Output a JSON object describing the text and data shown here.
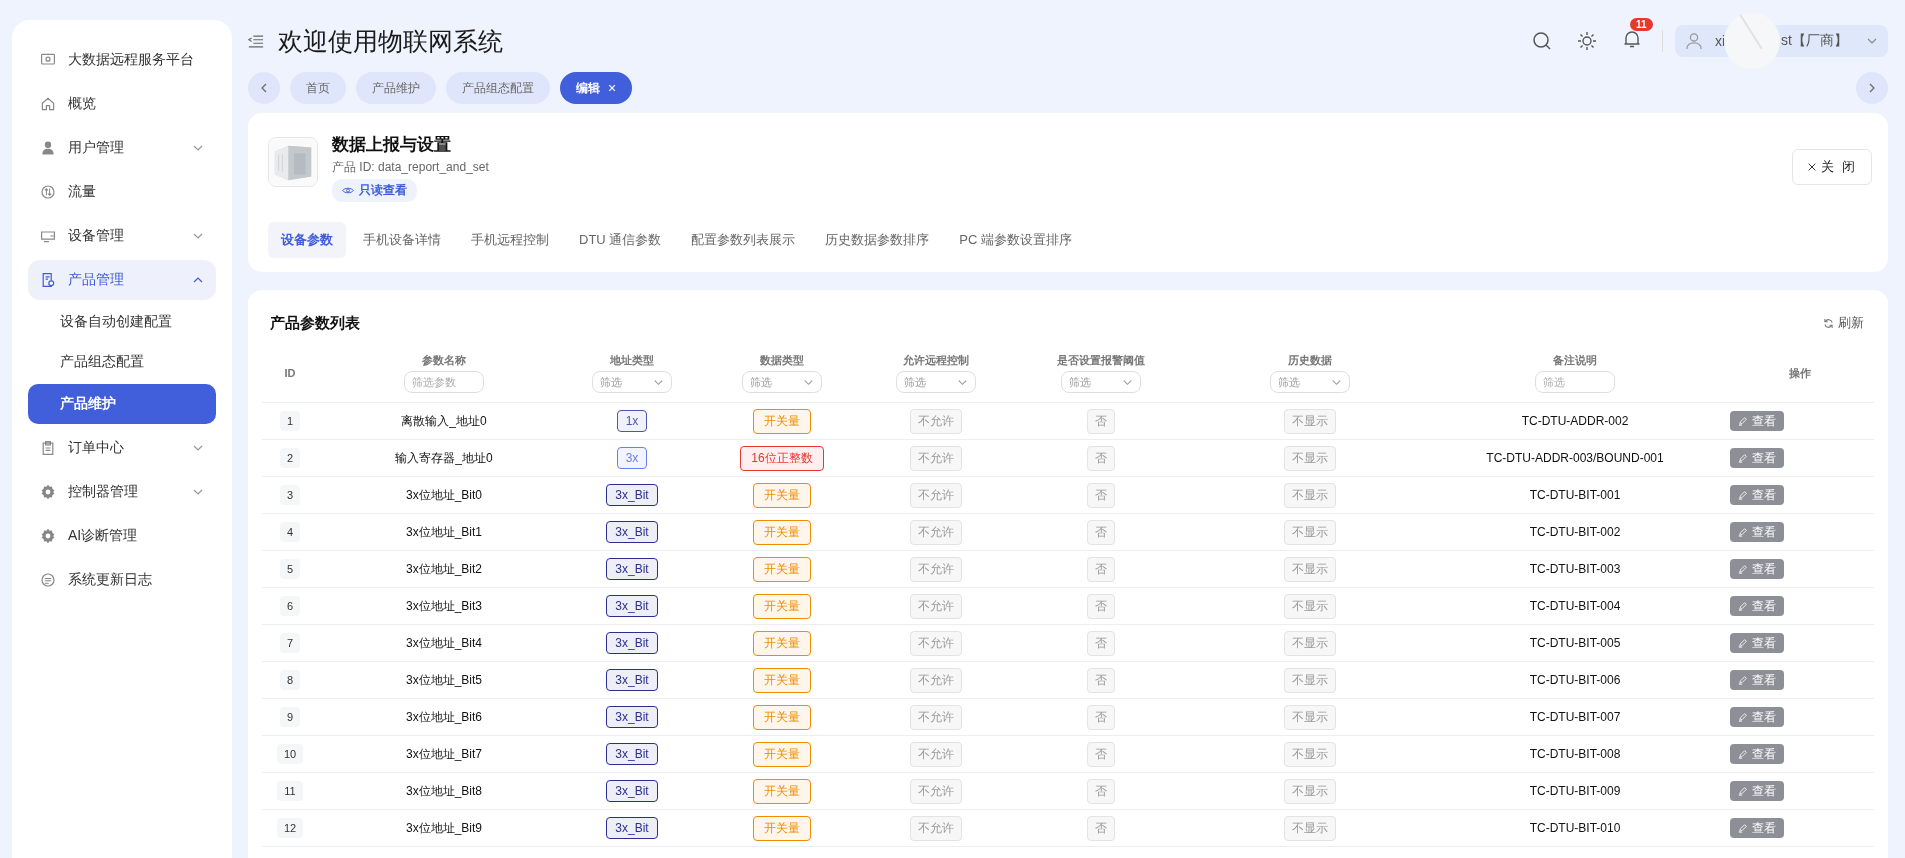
{
  "sidebar": {
    "items": [
      {
        "label": "大数据远程服务平台",
        "kind": "link",
        "selected": false
      },
      {
        "label": "概览",
        "kind": "link",
        "selected": false
      },
      {
        "label": "用户管理",
        "kind": "group",
        "expanded": false,
        "selected": false
      },
      {
        "label": "流量",
        "kind": "link",
        "selected": false
      },
      {
        "label": "设备管理",
        "kind": "group",
        "expanded": false,
        "selected": false
      },
      {
        "label": "产品管理",
        "kind": "group",
        "expanded": true,
        "selected": true,
        "children": [
          {
            "label": "设备自动创建配置",
            "selected": false
          },
          {
            "label": "产品组态配置",
            "selected": false
          },
          {
            "label": "产品维护",
            "selected": true
          }
        ]
      },
      {
        "label": "订单中心",
        "kind": "group",
        "expanded": false,
        "selected": false
      },
      {
        "label": "控制器管理",
        "kind": "group",
        "expanded": false,
        "selected": false
      },
      {
        "label": "AI诊断管理",
        "kind": "link",
        "selected": false
      },
      {
        "label": "系统更新日志",
        "kind": "link",
        "selected": false
      }
    ]
  },
  "header": {
    "title": "欢迎使用物联网系统",
    "notification_count": "11",
    "user": {
      "name_start": "xi",
      "name_end": "st【厂商】"
    }
  },
  "page_tabs": [
    {
      "label": "首页",
      "selected": false
    },
    {
      "label": "产品维护",
      "selected": false
    },
    {
      "label": "产品组态配置",
      "selected": false
    },
    {
      "label": "编辑",
      "selected": true,
      "close": "×"
    }
  ],
  "product": {
    "name": "数据上报与设置",
    "id_label": "产品 ID:",
    "id": "data_report_and_set",
    "badge": "只读查看",
    "close_button": "关 闭",
    "tabs": [
      {
        "label": "设备参数",
        "selected": true
      },
      {
        "label": "手机设备详情",
        "selected": false
      },
      {
        "label": "手机远程控制",
        "selected": false
      },
      {
        "label": "DTU 通信参数",
        "selected": false
      },
      {
        "label": "配置参数列表展示",
        "selected": false
      },
      {
        "label": "历史数据参数排序",
        "selected": false
      },
      {
        "label": "PC 端参数设置排序",
        "selected": false
      }
    ]
  },
  "table": {
    "title": "产品参数列表",
    "refresh": "刷新",
    "columns": [
      {
        "label": "ID"
      },
      {
        "label": "参数名称",
        "filter": {
          "kind": "text",
          "placeholder": "筛选参数"
        }
      },
      {
        "label": "地址类型",
        "filter": {
          "kind": "select",
          "placeholder": "筛选"
        }
      },
      {
        "label": "数据类型",
        "filter": {
          "kind": "select",
          "placeholder": "筛选"
        }
      },
      {
        "label": "允许远程控制",
        "filter": {
          "kind": "select",
          "placeholder": "筛选"
        }
      },
      {
        "label": "是否设置报警阈值",
        "filter": {
          "kind": "select",
          "placeholder": "筛选"
        }
      },
      {
        "label": "历史数据",
        "filter": {
          "kind": "select",
          "placeholder": "筛选"
        }
      },
      {
        "label": "备注说明",
        "filter": {
          "kind": "text",
          "placeholder": "筛选"
        }
      },
      {
        "label": "操作"
      }
    ],
    "rows": [
      {
        "id": "1",
        "name": "离散输入_地址0",
        "address": {
          "text": "1x",
          "color": "#4b54b8"
        },
        "data_type": {
          "text": "开关量",
          "color": "#f08c00"
        },
        "remote": "不允许",
        "alarm": "否",
        "history": "不显示",
        "note": "TC-DTU-ADDR-002",
        "action": "查看"
      },
      {
        "id": "2",
        "name": "输入寄存器_地址0",
        "address": {
          "text": "3x",
          "color": "#6b7cf5"
        },
        "data_type": {
          "text": "16位正整数",
          "color": "#e5382f"
        },
        "remote": "不允许",
        "alarm": "否",
        "history": "不显示",
        "note": "TC-DTU-ADDR-003/BOUND-001",
        "action": "查看"
      },
      {
        "id": "3",
        "name": "3x位地址_Bit0",
        "address": {
          "text": "3x_Bit",
          "color": "#2b2f8f"
        },
        "data_type": {
          "text": "开关量",
          "color": "#f08c00"
        },
        "remote": "不允许",
        "alarm": "否",
        "history": "不显示",
        "note": "TC-DTU-BIT-001",
        "action": "查看"
      },
      {
        "id": "4",
        "name": "3x位地址_Bit1",
        "address": {
          "text": "3x_Bit",
          "color": "#2b2f8f"
        },
        "data_type": {
          "text": "开关量",
          "color": "#f08c00"
        },
        "remote": "不允许",
        "alarm": "否",
        "history": "不显示",
        "note": "TC-DTU-BIT-002",
        "action": "查看"
      },
      {
        "id": "5",
        "name": "3x位地址_Bit2",
        "address": {
          "text": "3x_Bit",
          "color": "#2b2f8f"
        },
        "data_type": {
          "text": "开关量",
          "color": "#f08c00"
        },
        "remote": "不允许",
        "alarm": "否",
        "history": "不显示",
        "note": "TC-DTU-BIT-003",
        "action": "查看"
      },
      {
        "id": "6",
        "name": "3x位地址_Bit3",
        "address": {
          "text": "3x_Bit",
          "color": "#2b2f8f"
        },
        "data_type": {
          "text": "开关量",
          "color": "#f08c00"
        },
        "remote": "不允许",
        "alarm": "否",
        "history": "不显示",
        "note": "TC-DTU-BIT-004",
        "action": "查看"
      },
      {
        "id": "7",
        "name": "3x位地址_Bit4",
        "address": {
          "text": "3x_Bit",
          "color": "#2b2f8f"
        },
        "data_type": {
          "text": "开关量",
          "color": "#f08c00"
        },
        "remote": "不允许",
        "alarm": "否",
        "history": "不显示",
        "note": "TC-DTU-BIT-005",
        "action": "查看"
      },
      {
        "id": "8",
        "name": "3x位地址_Bit5",
        "address": {
          "text": "3x_Bit",
          "color": "#2b2f8f"
        },
        "data_type": {
          "text": "开关量",
          "color": "#f08c00"
        },
        "remote": "不允许",
        "alarm": "否",
        "history": "不显示",
        "note": "TC-DTU-BIT-006",
        "action": "查看"
      },
      {
        "id": "9",
        "name": "3x位地址_Bit6",
        "address": {
          "text": "3x_Bit",
          "color": "#2b2f8f"
        },
        "data_type": {
          "text": "开关量",
          "color": "#f08c00"
        },
        "remote": "不允许",
        "alarm": "否",
        "history": "不显示",
        "note": "TC-DTU-BIT-007",
        "action": "查看"
      },
      {
        "id": "10",
        "name": "3x位地址_Bit7",
        "address": {
          "text": "3x_Bit",
          "color": "#2b2f8f"
        },
        "data_type": {
          "text": "开关量",
          "color": "#f08c00"
        },
        "remote": "不允许",
        "alarm": "否",
        "history": "不显示",
        "note": "TC-DTU-BIT-008",
        "action": "查看"
      },
      {
        "id": "11",
        "name": "3x位地址_Bit8",
        "address": {
          "text": "3x_Bit",
          "color": "#2b2f8f"
        },
        "data_type": {
          "text": "开关量",
          "color": "#f08c00"
        },
        "remote": "不允许",
        "alarm": "否",
        "history": "不显示",
        "note": "TC-DTU-BIT-009",
        "action": "查看"
      },
      {
        "id": "12",
        "name": "3x位地址_Bit9",
        "address": {
          "text": "3x_Bit",
          "color": "#2b2f8f"
        },
        "data_type": {
          "text": "开关量",
          "color": "#f08c00"
        },
        "remote": "不允许",
        "alarm": "否",
        "history": "不显示",
        "note": "TC-DTU-BIT-010",
        "action": "查看"
      }
    ]
  }
}
